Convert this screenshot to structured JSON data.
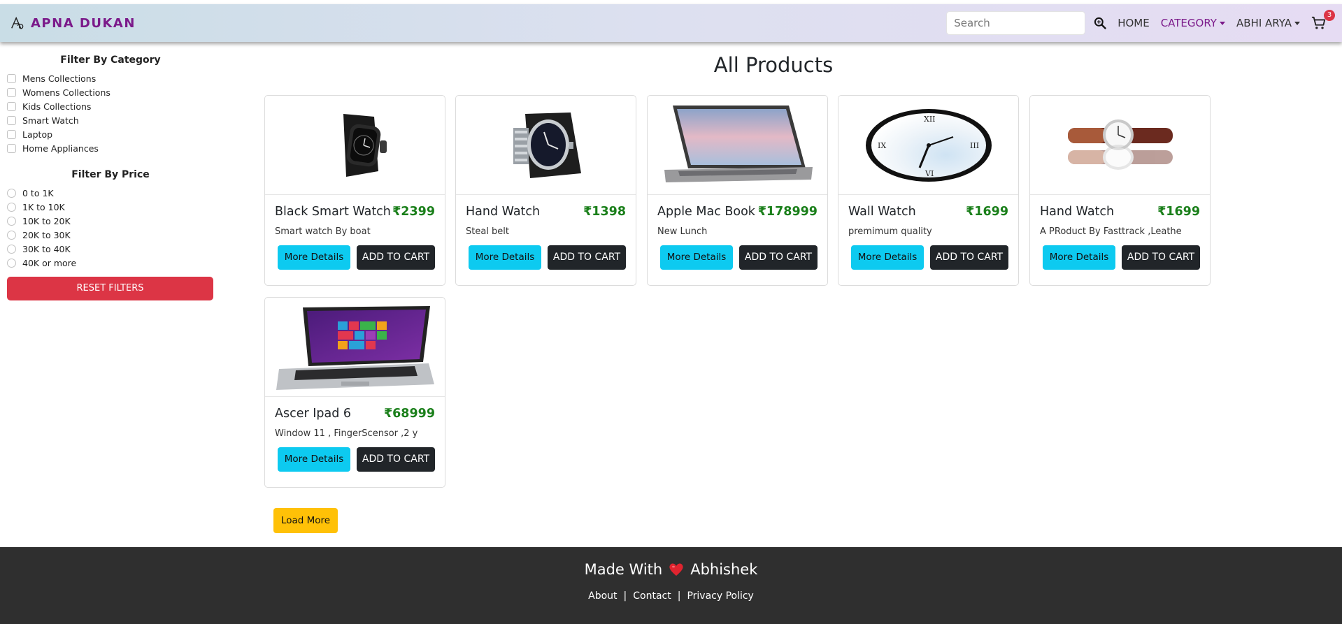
{
  "nav": {
    "brand": "APNA DUKAN",
    "search_placeholder": "Search",
    "links": {
      "home": "HOME",
      "category": "CATEGORY",
      "user": "ABHI ARYA"
    },
    "cart_count": "3",
    "icons": {
      "brand": "shop-logo-icon",
      "search": "search-icon",
      "cart": "cart-icon"
    }
  },
  "sidebar": {
    "category_title": "Filter By Category",
    "categories": [
      "Mens Collections",
      "Womens Collections",
      "Kids Collections",
      "Smart Watch",
      "Laptop",
      "Home Appliances"
    ],
    "price_title": "Filter By Price",
    "prices": [
      "0 to 1K",
      "1K to 10K",
      "10K to 20K",
      "20K to 30K",
      "30K to 40K",
      "40K or more"
    ],
    "reset_label": "RESET FILTERS"
  },
  "main": {
    "title": "All Products",
    "products": [
      {
        "name": "Black Smart Watch",
        "price": "₹2399",
        "desc": "Smart watch By boat",
        "image": "smartwatch"
      },
      {
        "name": "Hand Watch",
        "price": "₹1398",
        "desc": "Steal belt",
        "image": "steelwatch"
      },
      {
        "name": "Apple Mac Book",
        "price": "₹178999",
        "desc": "New Lunch",
        "image": "macbook"
      },
      {
        "name": "Wall Watch",
        "price": "₹1699",
        "desc": "premimum quality",
        "image": "wallclock"
      },
      {
        "name": "Hand Watch",
        "price": "₹1699",
        "desc": "A PRoduct By Fasttrack ,Leathe",
        "image": "leatherwatch"
      },
      {
        "name": "Ascer Ipad 6",
        "price": "₹68999",
        "desc": "Window 11 , FingerScensor ,2 y",
        "image": "laptop"
      }
    ],
    "details_label": "More Details",
    "cart_label": "ADD TO CART",
    "load_more": "Load More"
  },
  "footer": {
    "made_with": "Made With",
    "author": "Abhishek",
    "links": [
      "About",
      "Contact",
      "Privacy Policy"
    ],
    "separator": "|"
  },
  "colors": {
    "brand": "#7b1a8a",
    "price": "#1a7f1a",
    "reset": "#dc3545",
    "details": "#0dcaf0",
    "load_more": "#ffc107",
    "footer": "#2f2f2f"
  }
}
